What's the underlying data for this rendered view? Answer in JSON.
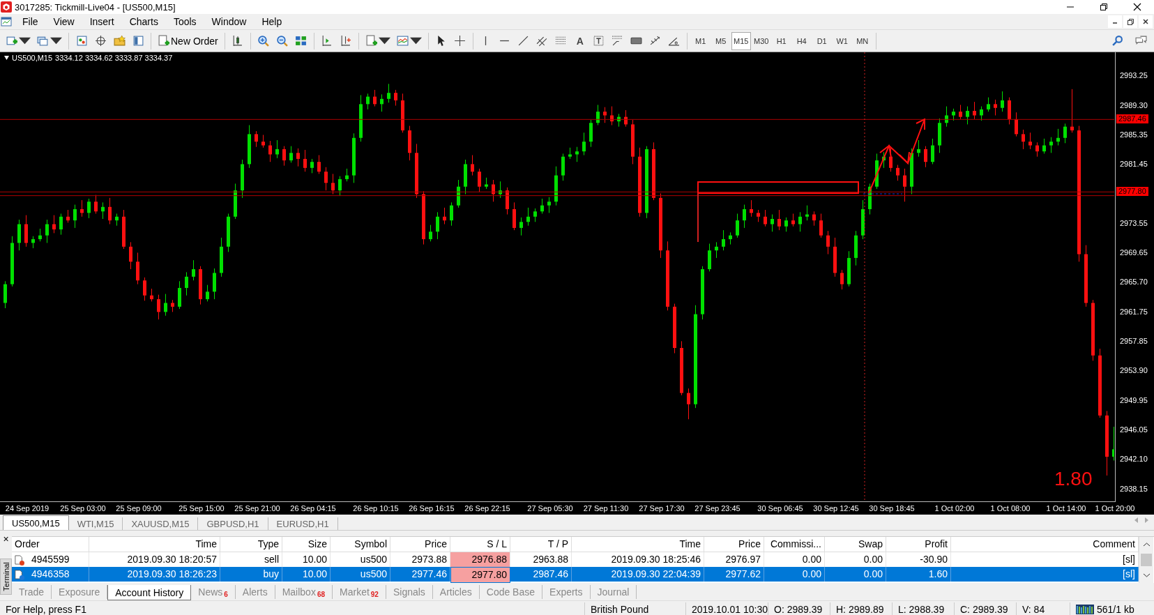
{
  "window": {
    "title": "3017285: Tickmill-Live04 - [US500,M15]"
  },
  "menu": [
    "File",
    "View",
    "Insert",
    "Charts",
    "Tools",
    "Window",
    "Help"
  ],
  "toolbar": {
    "new_order": "New Order",
    "text_tool": "A",
    "timeframes": [
      {
        "label": "M1",
        "selected": false
      },
      {
        "label": "M5",
        "selected": false
      },
      {
        "label": "M15",
        "selected": true
      },
      {
        "label": "M30",
        "selected": false
      },
      {
        "label": "H1",
        "selected": false
      },
      {
        "label": "H4",
        "selected": false
      },
      {
        "label": "D1",
        "selected": false
      },
      {
        "label": "W1",
        "selected": false
      },
      {
        "label": "MN",
        "selected": false
      }
    ]
  },
  "chart": {
    "symbol": "US500,M15",
    "quote": "3334.12 3334.62 3333.87 3334.37",
    "profit_label": "1.80",
    "chart_data": {
      "type": "candlestick",
      "categories": [
        null,
        null,
        null,
        "24 Sep 2019",
        null,
        null,
        null,
        null,
        null,
        null,
        null,
        "25 Sep 03:00",
        null,
        null,
        null,
        null,
        null,
        null,
        null,
        "25 Sep 09:00",
        null,
        null,
        null,
        null,
        null,
        null,
        null,
        null,
        "25 Sep 15:00",
        null,
        null,
        null,
        null,
        null,
        null,
        null,
        "25 Sep 21:00",
        null,
        null,
        null,
        null,
        null,
        null,
        null,
        "26 Sep 04:15",
        null,
        null,
        null,
        null,
        null,
        null,
        null,
        null,
        "26 Sep 10:15",
        null,
        null,
        null,
        null,
        null,
        null,
        null,
        "26 Sep 16:15",
        null,
        null,
        null,
        null,
        null,
        null,
        null,
        "26 Sep 22:15",
        null,
        null,
        null,
        null,
        null,
        null,
        null,
        null,
        "27 Sep 05:30",
        null,
        null,
        null,
        null,
        null,
        null,
        null,
        "27 Sep 11:30",
        null,
        null,
        null,
        null,
        null,
        null,
        null,
        "27 Sep 17:30",
        null,
        null,
        null,
        null,
        null,
        null,
        null,
        "27 Sep 23:45",
        null,
        null,
        null,
        null,
        null,
        null,
        null,
        null,
        "30 Sep 06:45",
        null,
        null,
        null,
        null,
        null,
        null,
        null,
        "30 Sep 12:45",
        null,
        null,
        null,
        null,
        null,
        null,
        null,
        "30 Sep 18:45",
        null,
        null,
        null,
        null,
        null,
        null,
        null,
        null,
        "1 Oct 02:00",
        null,
        null,
        null,
        null,
        null,
        null,
        null,
        "1 Oct 08:00",
        null,
        null,
        null,
        null,
        null,
        null,
        null,
        "1 Oct 14:00",
        null,
        null,
        null,
        null,
        null,
        null,
        "1 Oct 20:00"
      ],
      "ohlc": [
        [
          2963.0,
          2965.9,
          2962.3,
          2965.5
        ],
        [
          2965.5,
          2971.9,
          2965.2,
          2971.0
        ],
        [
          2971.0,
          2974.1,
          2970.0,
          2973.5
        ],
        [
          2973.5,
          2974.7,
          2970.5,
          2971.0
        ],
        [
          2971.0,
          2971.9,
          2970.3,
          2971.5
        ],
        [
          2971.5,
          2972.9,
          2971.2,
          2972.0
        ],
        [
          2972.0,
          2974.1,
          2971.0,
          2973.5
        ],
        [
          2973.5,
          2974.7,
          2972.3,
          2972.8
        ],
        [
          2972.8,
          2974.9,
          2972.1,
          2974.5
        ],
        [
          2974.5,
          2975.4,
          2973.7,
          2974.0
        ],
        [
          2974.0,
          2976.1,
          2973.0,
          2975.5
        ],
        [
          2975.5,
          2976.7,
          2974.5,
          2975.0
        ],
        [
          2975.0,
          2976.9,
          2974.3,
          2976.5
        ],
        [
          2976.5,
          2977.4,
          2974.9,
          2975.2
        ],
        [
          2975.2,
          2976.4,
          2974.2,
          2975.8
        ],
        [
          2975.8,
          2977.0,
          2973.5,
          2974.0
        ],
        [
          2974.0,
          2974.9,
          2973.3,
          2974.5
        ],
        [
          2974.5,
          2975.4,
          2970.2,
          2970.5
        ],
        [
          2970.5,
          2971.1,
          2967.5,
          2968.5
        ],
        [
          2968.5,
          2969.7,
          2965.5,
          2966.0
        ],
        [
          2966.0,
          2966.4,
          2963.3,
          2964.0
        ],
        [
          2964.0,
          2964.9,
          2963.2,
          2963.5
        ],
        [
          2963.5,
          2964.1,
          2960.8,
          2961.8
        ],
        [
          2961.8,
          2964.2,
          2961.3,
          2963.0
        ],
        [
          2963.0,
          2963.4,
          2961.8,
          2962.5
        ],
        [
          2962.5,
          2965.9,
          2962.2,
          2965.0
        ],
        [
          2965.0,
          2967.1,
          2964.0,
          2966.5
        ],
        [
          2966.5,
          2968.7,
          2966.0,
          2967.5
        ],
        [
          2967.5,
          2967.9,
          2962.8,
          2963.5
        ],
        [
          2963.5,
          2965.4,
          2963.2,
          2964.5
        ],
        [
          2964.5,
          2967.6,
          2963.5,
          2967.0
        ],
        [
          2967.0,
          2971.7,
          2966.5,
          2970.5
        ],
        [
          2970.5,
          2974.9,
          2969.8,
          2974.5
        ],
        [
          2974.5,
          2978.9,
          2974.2,
          2978.0
        ],
        [
          2978.0,
          2982.1,
          2977.0,
          2981.5
        ],
        [
          2981.5,
          2986.7,
          2981.0,
          2985.5
        ],
        [
          2985.5,
          2985.9,
          2983.8,
          2984.5
        ],
        [
          2984.5,
          2985.4,
          2983.7,
          2984.0
        ],
        [
          2984.0,
          2984.6,
          2981.8,
          2982.8
        ],
        [
          2982.8,
          2984.7,
          2982.3,
          2983.5
        ],
        [
          2983.5,
          2983.9,
          2981.3,
          2982.0
        ],
        [
          2982.0,
          2983.9,
          2981.7,
          2983.0
        ],
        [
          2983.0,
          2983.6,
          2981.2,
          2982.2
        ],
        [
          2982.2,
          2983.4,
          2980.5,
          2981.0
        ],
        [
          2981.0,
          2982.2,
          2980.3,
          2981.8
        ],
        [
          2981.8,
          2982.7,
          2980.2,
          2980.5
        ],
        [
          2980.5,
          2981.1,
          2978.0,
          2979.0
        ],
        [
          2979.0,
          2980.2,
          2977.5,
          2978.0
        ],
        [
          2978.0,
          2979.9,
          2977.3,
          2979.5
        ],
        [
          2979.5,
          2980.9,
          2979.2,
          2980.0
        ],
        [
          2980.0,
          2985.6,
          2979.0,
          2985.0
        ],
        [
          2985.0,
          2990.7,
          2984.5,
          2989.5
        ],
        [
          2989.5,
          2990.9,
          2988.8,
          2990.5
        ],
        [
          2990.5,
          2991.4,
          2989.2,
          2989.5
        ],
        [
          2989.5,
          2990.8,
          2988.5,
          2990.2
        ],
        [
          2990.2,
          2992.2,
          2989.7,
          2991.0
        ],
        [
          2991.0,
          2991.4,
          2989.3,
          2990.0
        ],
        [
          2990.0,
          2990.9,
          2985.7,
          2986.0
        ],
        [
          2986.0,
          2986.6,
          2982.0,
          2983.0
        ],
        [
          2983.0,
          2984.2,
          2977.0,
          2977.5
        ],
        [
          2977.5,
          2977.9,
          2970.8,
          2971.5
        ],
        [
          2971.5,
          2973.4,
          2971.2,
          2972.5
        ],
        [
          2972.5,
          2975.1,
          2971.5,
          2974.5
        ],
        [
          2974.5,
          2975.7,
          2973.5,
          2974.0
        ],
        [
          2974.0,
          2976.4,
          2973.3,
          2976.0
        ],
        [
          2976.0,
          2979.4,
          2975.7,
          2978.5
        ],
        [
          2978.5,
          2982.1,
          2977.5,
          2981.5
        ],
        [
          2981.5,
          2982.7,
          2980.0,
          2980.5
        ],
        [
          2980.5,
          2980.9,
          2977.8,
          2978.5
        ],
        [
          2978.5,
          2979.7,
          2978.2,
          2978.8
        ],
        [
          2978.8,
          2979.4,
          2976.5,
          2977.5
        ],
        [
          2977.5,
          2979.2,
          2977.0,
          2978.0
        ],
        [
          2978.0,
          2978.4,
          2974.8,
          2975.5
        ],
        [
          2975.5,
          2976.4,
          2972.7,
          2973.0
        ],
        [
          2973.0,
          2974.4,
          2972.0,
          2973.8
        ],
        [
          2973.8,
          2975.7,
          2973.3,
          2974.5
        ],
        [
          2974.5,
          2975.6,
          2973.8,
          2975.2
        ],
        [
          2975.2,
          2976.9,
          2974.9,
          2976.0
        ],
        [
          2976.0,
          2977.1,
          2975.0,
          2976.5
        ],
        [
          2976.5,
          2981.2,
          2976.0,
          2980.0
        ],
        [
          2980.0,
          2982.9,
          2979.3,
          2982.5
        ],
        [
          2982.5,
          2983.7,
          2982.2,
          2982.8
        ],
        [
          2982.8,
          2983.8,
          2981.8,
          2983.2
        ],
        [
          2983.2,
          2985.7,
          2982.7,
          2984.5
        ],
        [
          2984.5,
          2987.4,
          2983.8,
          2987.0
        ],
        [
          2987.0,
          2989.4,
          2986.7,
          2988.5
        ],
        [
          2988.5,
          2989.1,
          2987.0,
          2988.0
        ],
        [
          2988.0,
          2989.2,
          2986.7,
          2987.2
        ],
        [
          2987.2,
          2988.2,
          2986.5,
          2987.8
        ],
        [
          2987.8,
          2988.7,
          2986.5,
          2986.8
        ],
        [
          2986.8,
          2987.4,
          2981.5,
          2982.5
        ],
        [
          2982.5,
          2983.7,
          2974.5,
          2975.0
        ],
        [
          2975.0,
          2983.9,
          2974.3,
          2983.5
        ],
        [
          2983.5,
          2984.4,
          2976.7,
          2977.0
        ],
        [
          2977.0,
          2977.6,
          2969.0,
          2970.0
        ],
        [
          2970.0,
          2971.2,
          2962.0,
          2962.5
        ],
        [
          2962.5,
          2962.9,
          2956.3,
          2957.0
        ],
        [
          2957.0,
          2957.9,
          2950.7,
          2951.0
        ],
        [
          2951.0,
          2951.6,
          2947.5,
          2949.5
        ],
        [
          2949.5,
          2962.7,
          2949.0,
          2961.5
        ],
        [
          2961.5,
          2967.9,
          2960.8,
          2967.5
        ],
        [
          2967.5,
          2970.9,
          2967.2,
          2970.0
        ],
        [
          2970.0,
          2971.1,
          2969.0,
          2970.5
        ],
        [
          2970.5,
          2972.7,
          2970.0,
          2971.5
        ],
        [
          2971.5,
          2972.4,
          2970.8,
          2972.0
        ],
        [
          2972.0,
          2974.9,
          2971.7,
          2974.0
        ],
        [
          2974.0,
          2976.1,
          2973.0,
          2975.5
        ],
        [
          2975.5,
          2976.7,
          2974.5,
          2975.0
        ],
        [
          2975.0,
          2975.4,
          2973.8,
          2974.5
        ],
        [
          2974.5,
          2975.4,
          2973.2,
          2973.5
        ],
        [
          2973.5,
          2974.8,
          2972.5,
          2974.2
        ],
        [
          2974.2,
          2975.4,
          2972.7,
          2973.2
        ],
        [
          2973.2,
          2974.4,
          2972.5,
          2974.0
        ],
        [
          2974.0,
          2974.9,
          2973.2,
          2973.5
        ],
        [
          2973.5,
          2975.1,
          2972.5,
          2974.5
        ],
        [
          2974.5,
          2976.0,
          2974.0,
          2974.8
        ],
        [
          2974.8,
          2975.2,
          2973.3,
          2974.0
        ],
        [
          2974.0,
          2974.9,
          2971.7,
          2972.0
        ],
        [
          2972.0,
          2972.6,
          2969.5,
          2970.5
        ],
        [
          2970.5,
          2971.7,
          2966.5,
          2967.0
        ],
        [
          2967.0,
          2967.4,
          2964.8,
          2965.5
        ],
        [
          2965.5,
          2969.9,
          2965.2,
          2969.0
        ],
        [
          2969.0,
          2972.6,
          2968.0,
          2972.0
        ],
        [
          2972.0,
          2976.7,
          2971.5,
          2975.5
        ],
        [
          2975.5,
          2978.9,
          2974.8,
          2978.5
        ],
        [
          2978.5,
          2982.9,
          2978.2,
          2982.0
        ],
        [
          2982.0,
          2983.1,
          2981.0,
          2982.5
        ],
        [
          2982.5,
          2983.7,
          2980.5,
          2981.0
        ],
        [
          2981.0,
          2981.4,
          2979.3,
          2980.0
        ],
        [
          2980.0,
          2980.9,
          2976.5,
          2978.5
        ],
        [
          2978.5,
          2983.6,
          2977.5,
          2983.0
        ],
        [
          2983.0,
          2984.7,
          2982.5,
          2983.5
        ],
        [
          2983.5,
          2983.9,
          2981.1,
          2981.8
        ],
        [
          2981.8,
          2984.9,
          2981.5,
          2984.0
        ],
        [
          2984.0,
          2987.6,
          2983.0,
          2987.0
        ],
        [
          2987.0,
          2989.2,
          2986.5,
          2988.0
        ],
        [
          2988.0,
          2988.9,
          2987.3,
          2988.5
        ],
        [
          2988.5,
          2989.4,
          2987.5,
          2987.8
        ],
        [
          2987.8,
          2989.2,
          2986.8,
          2988.6
        ],
        [
          2988.6,
          2989.8,
          2987.5,
          2988.0
        ],
        [
          2988.0,
          2989.2,
          2987.3,
          2988.8
        ],
        [
          2988.8,
          2990.4,
          2988.5,
          2989.5
        ],
        [
          2989.5,
          2990.1,
          2988.0,
          2989.0
        ],
        [
          2989.0,
          2991.2,
          2988.5,
          2990.0
        ],
        [
          2990.0,
          2990.4,
          2986.8,
          2987.5
        ],
        [
          2987.5,
          2988.4,
          2985.2,
          2985.5
        ],
        [
          2985.5,
          2986.1,
          2983.5,
          2984.5
        ],
        [
          2984.5,
          2985.7,
          2983.5,
          2984.0
        ],
        [
          2984.0,
          2984.4,
          2982.5,
          2983.2
        ],
        [
          2983.2,
          2984.9,
          2982.9,
          2984.0
        ],
        [
          2984.0,
          2985.1,
          2983.0,
          2984.5
        ],
        [
          2984.5,
          2986.2,
          2984.0,
          2985.0
        ],
        [
          2985.0,
          2986.9,
          2984.3,
          2986.5
        ],
        [
          2986.5,
          2991.5,
          2985.7,
          2986.0
        ],
        [
          2986.0,
          2986.6,
          2968.5,
          2969.5
        ],
        [
          2969.5,
          2970.7,
          2962.5,
          2963.0
        ],
        [
          2963.0,
          2963.4,
          2955.3,
          2956.0
        ],
        [
          2956.0,
          2956.9,
          2947.7,
          2948.0
        ],
        [
          2948.0,
          2948.6,
          2940.0,
          2942.5
        ],
        [
          2942.5,
          2946.5,
          2942.0,
          2943.5
        ]
      ],
      "ylim": [
        2936.65,
        2996.41
      ],
      "yticks": [
        {
          "value": 2993.25,
          "label": "2993.25"
        },
        {
          "value": 2989.3,
          "label": "2989.30"
        },
        {
          "value": 2985.35,
          "label": "2985.35"
        },
        {
          "value": 2981.45,
          "label": "2981.45"
        },
        {
          "value": 2973.55,
          "label": "2973.55"
        },
        {
          "value": 2969.65,
          "label": "2969.65"
        },
        {
          "value": 2965.7,
          "label": "2965.70"
        },
        {
          "value": 2961.75,
          "label": "2961.75"
        },
        {
          "value": 2957.85,
          "label": "2957.85"
        },
        {
          "value": 2953.9,
          "label": "2953.90"
        },
        {
          "value": 2949.95,
          "label": "2949.95"
        },
        {
          "value": 2946.05,
          "label": "2946.05"
        },
        {
          "value": 2942.1,
          "label": "2942.10"
        },
        {
          "value": 2938.15,
          "label": "2938.15"
        }
      ],
      "ref_lines": [
        {
          "axis": "y",
          "value": 2987.46,
          "label": "2987.46"
        },
        {
          "axis": "y",
          "value": 2977.8,
          "label": "2977.80"
        },
        {
          "axis": "y",
          "value": 2977.3
        }
      ]
    }
  },
  "chart_tabs": [
    {
      "label": "US500,M15",
      "selected": true
    },
    {
      "label": "WTI,M15",
      "selected": false
    },
    {
      "label": "XAUUSD,M15",
      "selected": false
    },
    {
      "label": "GBPUSD,H1",
      "selected": false
    },
    {
      "label": "EURUSD,H1",
      "selected": false
    }
  ],
  "terminal": {
    "title": "Terminal",
    "close": "×",
    "columns": [
      "Order",
      "Time",
      "Type",
      "Size",
      "Symbol",
      "Price",
      "S / L",
      "T / P",
      "Time",
      "Price",
      "Commissi...",
      "Swap",
      "Profit",
      "Comment"
    ],
    "rows": [
      {
        "selected": false,
        "color": "#e0401c",
        "cells": [
          "4945599",
          "2019.09.30 18:20:57",
          "sell",
          "10.00",
          "us500",
          "2973.88",
          "2976.88",
          "2963.88",
          "2019.09.30 18:25:46",
          "2976.97",
          "0.00",
          "0.00",
          "-30.90",
          "[sl]"
        ]
      },
      {
        "selected": true,
        "color": "#1c78d8",
        "cells": [
          "4946358",
          "2019.09.30 18:26:23",
          "buy",
          "10.00",
          "us500",
          "2977.46",
          "2977.80",
          "2987.46",
          "2019.09.30 22:04:39",
          "2977.62",
          "0.00",
          "0.00",
          "1.60",
          "[sl]"
        ]
      }
    ],
    "tabs": [
      {
        "label": "Trade",
        "selected": false
      },
      {
        "label": "Exposure",
        "selected": false
      },
      {
        "label": "Account History",
        "selected": true
      },
      {
        "label": "News",
        "count": "6",
        "selected": false
      },
      {
        "label": "Alerts",
        "selected": false
      },
      {
        "label": "Mailbox",
        "count": "68",
        "selected": false
      },
      {
        "label": "Market",
        "count": "92",
        "selected": false
      },
      {
        "label": "Signals",
        "selected": false
      },
      {
        "label": "Articles",
        "selected": false
      },
      {
        "label": "Code Base",
        "selected": false
      },
      {
        "label": "Experts",
        "selected": false
      },
      {
        "label": "Journal",
        "selected": false
      }
    ]
  },
  "status_bar": {
    "help": "For Help, press F1",
    "profile": "British Pound",
    "time": "2019.10.01 10:30",
    "open": "O: 2989.39",
    "high": "H: 2989.89",
    "low": "L: 2988.39",
    "close": "C: 2989.39",
    "volume": "V: 84",
    "traffic": "561/1 kb"
  }
}
